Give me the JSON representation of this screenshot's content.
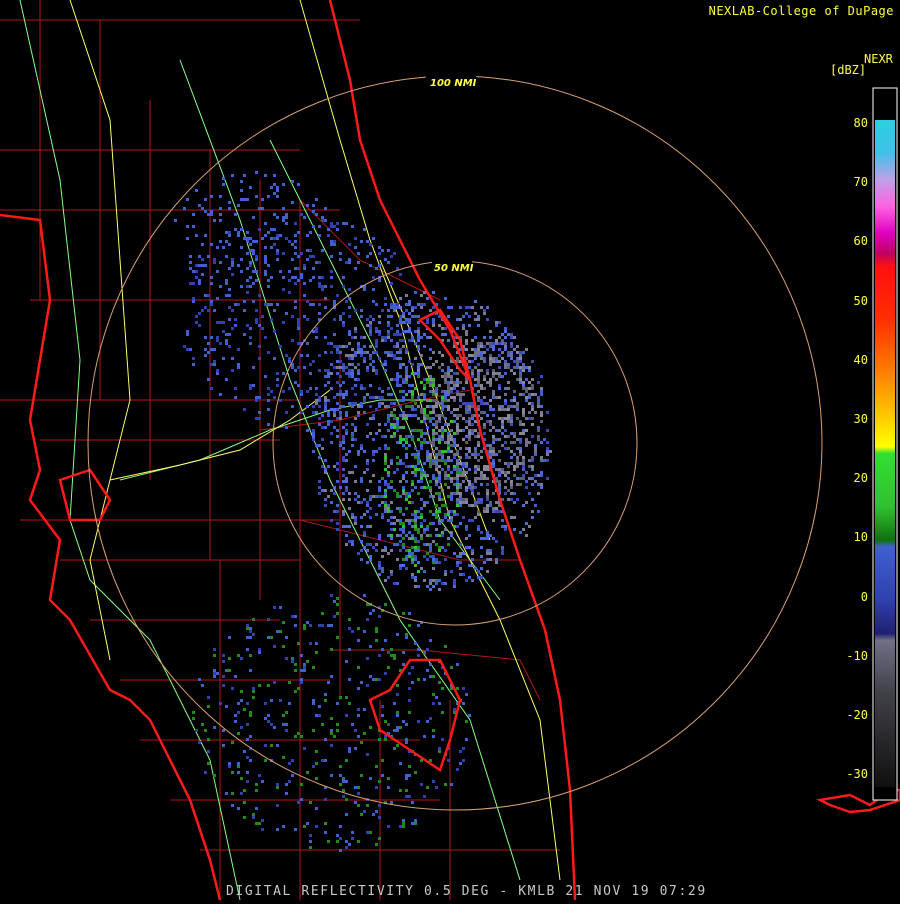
{
  "credit": "NEXLAB-College of DuPage",
  "product_label": "NEXR",
  "units_label": "[dBZ]",
  "footer": "DIGITAL REFLECTIVITY 0.5 DEG - KMLB 21 NOV 19 07:29",
  "range_rings": [
    {
      "label": "100 NMI"
    },
    {
      "label": "50 NMI"
    }
  ],
  "legend": {
    "ticks": [
      "80",
      "70",
      "60",
      "50",
      "40",
      "30",
      "20",
      "10",
      "0",
      "-10",
      "-20",
      "-30"
    ],
    "colors": {
      "range_ring": "#d8a070",
      "coast": "#ff1a1a",
      "county": "#b01818",
      "highway": "#ffff66",
      "road": "#88ff88"
    }
  }
}
